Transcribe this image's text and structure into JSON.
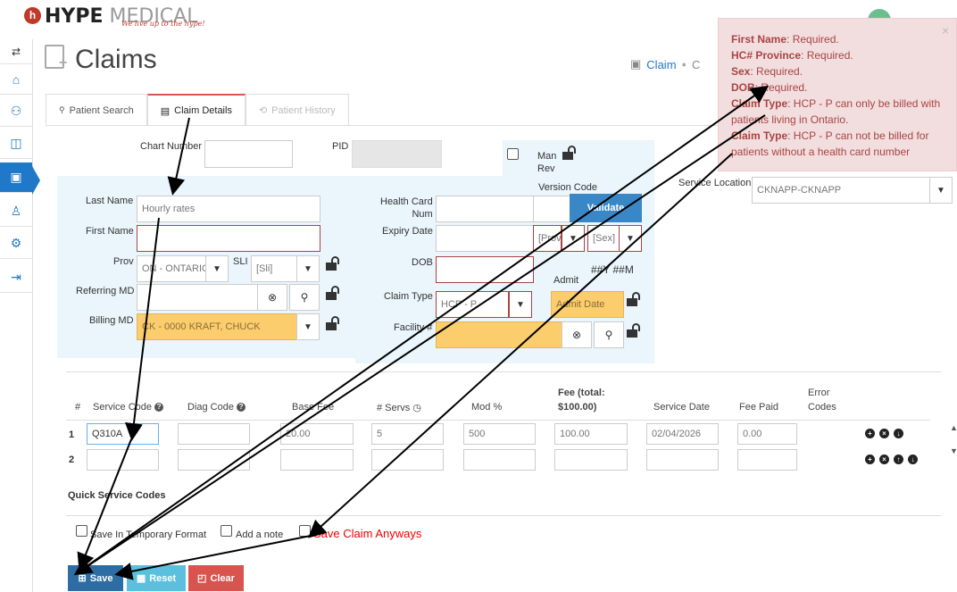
{
  "brand": {
    "name_bold": "HYPE",
    "name_light": "MEDICAL",
    "tagline": "We live up to the hype!",
    "logo_letter": "h"
  },
  "sidebar": {
    "items": [
      {
        "icon": "swap-arrows-icon",
        "glyph": "⇆"
      },
      {
        "icon": "home-icon",
        "glyph": "⌂"
      },
      {
        "icon": "users-icon",
        "glyph": "⚇"
      },
      {
        "icon": "book-icon",
        "glyph": "◫"
      },
      {
        "icon": "briefcase-icon",
        "glyph": "▣"
      },
      {
        "icon": "user-admin-icon",
        "glyph": "♙"
      },
      {
        "icon": "settings-icon",
        "glyph": "⚙"
      },
      {
        "icon": "logout-icon",
        "glyph": "⇥"
      }
    ]
  },
  "page": {
    "title": "Claims",
    "breadcrumb": {
      "item1": "Claim",
      "item2": "C"
    }
  },
  "tabs": [
    {
      "label": "Patient Search",
      "icon": "🔍"
    },
    {
      "label": "Claim Details",
      "icon": "▤"
    },
    {
      "label": "Patient History",
      "icon": "⟲"
    }
  ],
  "form": {
    "chart_number_label": "Chart Number",
    "pid_label": "PID",
    "man_rev_label": "Man\nRev",
    "version_code_label": "Version Code",
    "last_name_label": "Last Name",
    "last_name_value": "Hourly rates",
    "first_name_label": "First Name",
    "prov_label": "Prov",
    "prov_value": "ON - ONTARIO",
    "sli_label": "SLI",
    "sli_value": "[Sli]",
    "referring_md_label": "Referring MD",
    "billing_md_label": "Billing MD",
    "billing_md_value": "CK - 0000 KRAFT, CHUCK",
    "health_card_label": "Health Card\nNum",
    "validate_label": "Validate",
    "expiry_date_label": "Expiry Date",
    "prov_short": "[Prov",
    "sex_value": "[Sex]",
    "dob_label": "DOB",
    "dob_hint": "##Y ##M",
    "admit_label": "Admit",
    "admit_placeholder": "Admit Date",
    "claim_type_label": "Claim Type",
    "claim_type_value": "HCP - P",
    "facility_label": "Facility #",
    "service_location_label": "Service Location",
    "service_location_value": "CKNAPP-CKNAPP"
  },
  "table": {
    "headers": {
      "num": "#",
      "service_code": "Service Code",
      "diag_code": "Diag Code",
      "base_fee": "Base Fee",
      "servs": "# Servs",
      "mod": "Mod %",
      "fee_line1": "Fee (total:",
      "fee_line2": "$100.00)",
      "service_date": "Service Date",
      "fee_paid": "Fee Paid",
      "error_line1": "Error",
      "error_line2": "Codes"
    },
    "rows": [
      {
        "num": "1",
        "service_code": "Q310A",
        "diag_code": "",
        "base_fee": "20.00",
        "servs": "5",
        "mod": "500",
        "fee": "100.00",
        "service_date": "02/04/2026",
        "fee_paid": "0.00"
      },
      {
        "num": "2",
        "service_code": "",
        "diag_code": "",
        "base_fee": "",
        "servs": "",
        "mod": "",
        "fee": "",
        "service_date": "",
        "fee_paid": ""
      }
    ]
  },
  "quick_codes_label": "Quick Service Codes",
  "options": {
    "temp_format": "Save In Temporary Format",
    "add_note": "Add a note",
    "save_anyways": "Save Claim Anyways"
  },
  "buttons": {
    "save": "Save",
    "reset": "Reset",
    "clear": "Clear"
  },
  "alert": {
    "close": "×",
    "lines": [
      {
        "key": "First Name",
        "msg": ": Required."
      },
      {
        "key": "HC# Province",
        "msg": ": Required."
      },
      {
        "key": "Sex",
        "msg": ": Required."
      },
      {
        "key": "DOB",
        "msg": ": Required."
      },
      {
        "key": "Claim Type",
        "msg": ": HCP - P can only be billed with patients living in Ontario."
      },
      {
        "key": "Claim Type",
        "msg": ": HCP - P can not be billed for patients without a health card number"
      }
    ]
  },
  "colors": {
    "primary": "#1f78c8",
    "error": "#a94442",
    "alert_bg": "#f2dede",
    "billing_bg": "#fbcd6c",
    "clear_btn": "#d9534f",
    "reset_btn": "#5bc0de"
  }
}
